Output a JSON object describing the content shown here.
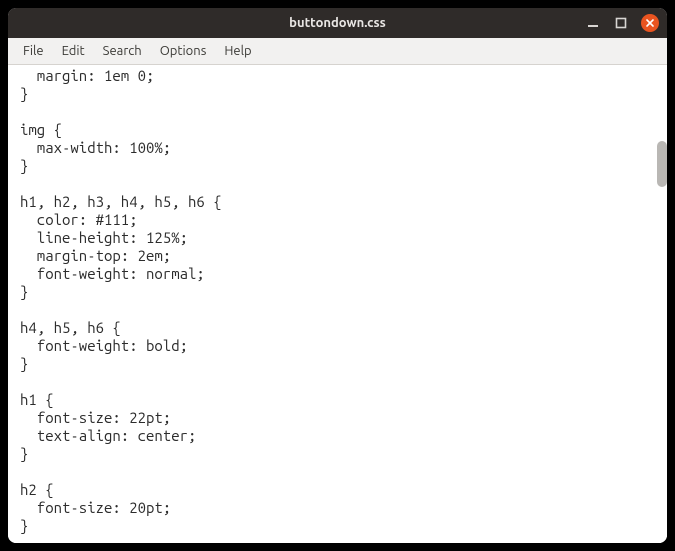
{
  "window": {
    "title": "buttondown.css"
  },
  "menubar": {
    "items": [
      "File",
      "Edit",
      "Search",
      "Options",
      "Help"
    ]
  },
  "editor": {
    "content": "  margin: 1em 0;\n}\n\nimg {\n  max-width: 100%;\n}\n\nh1, h2, h3, h4, h5, h6 {\n  color: #111;\n  line-height: 125%;\n  margin-top: 2em;\n  font-weight: normal;\n}\n\nh4, h5, h6 {\n  font-weight: bold;\n}\n\nh1 {\n  font-size: 22pt;\n  text-align: center;\n}\n\nh2 {\n  font-size: 20pt;\n}"
  }
}
